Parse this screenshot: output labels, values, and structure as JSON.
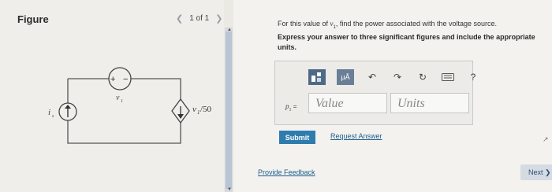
{
  "figure_panel": {
    "title": "Figure",
    "pager": "1 of 1",
    "circuit": {
      "source_label": "i",
      "source_sub": "s",
      "resistor_plus": "+",
      "resistor_minus": "−",
      "resistor_var": "v",
      "resistor_sub": "1",
      "dep_source_label": "v",
      "dep_source_sub": "1",
      "dep_source_tail": "/50"
    }
  },
  "problem": {
    "question_prefix": "For this value of",
    "question_var": "v",
    "question_sub": "1",
    "question_suffix": ", find the power associated with the voltage source.",
    "instruction": "Express your answer to three significant figures and include the appropriate units."
  },
  "answer": {
    "var": "p",
    "var_sub": "1",
    "equals": "=",
    "value_placeholder": "Value",
    "units_placeholder": "Units",
    "toolbar_unit_label": "μÅ",
    "toolbar_help": "?"
  },
  "actions": {
    "submit": "Submit",
    "request": "Request Answer",
    "feedback": "Provide Feedback",
    "next": "Next ❯"
  },
  "colors": {
    "submit_bg": "#2e7cae",
    "link": "#1d5e8c",
    "toolbar_dark": "#4e6a87"
  }
}
